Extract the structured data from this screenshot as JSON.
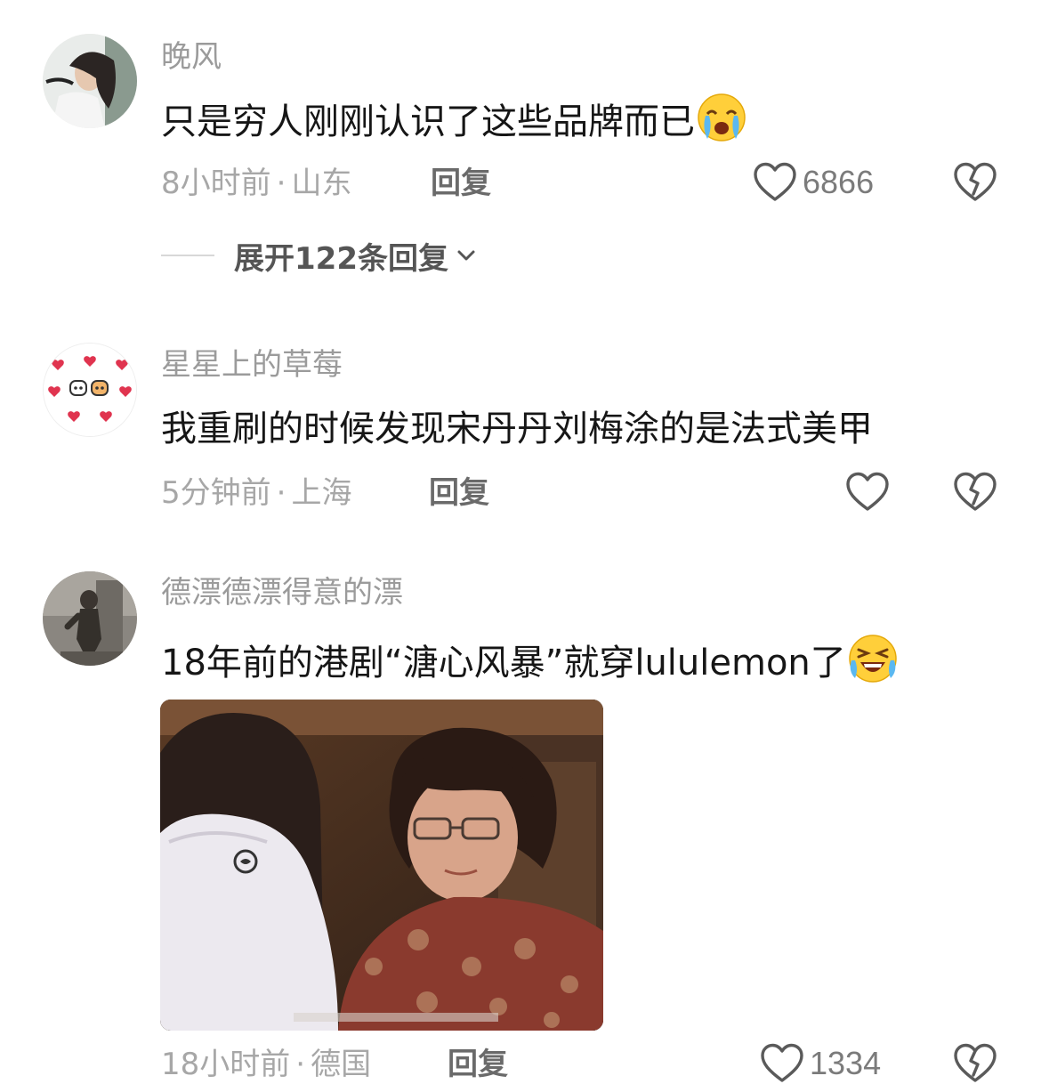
{
  "comments": [
    {
      "username": "晚风",
      "text": "只是穷人刚刚认识了这些品牌而已",
      "emoji": "crying-face-emoji",
      "time": "8小时前",
      "separator": "·",
      "location": "山东",
      "reply_label": "回复",
      "likes": "6866",
      "expand_label": "展开122条回复"
    },
    {
      "username": "星星上的草莓",
      "text": "我重刷的时候发现宋丹丹刘梅涂的是法式美甲",
      "time": "5分钟前",
      "separator": "·",
      "location": "上海",
      "reply_label": "回复",
      "likes": ""
    },
    {
      "username": "德漂德漂得意的漂",
      "text": "18年前的港剧“溏心风暴”就穿lululemon了",
      "emoji": "rolling-laughing-emoji",
      "time": "18小时前",
      "separator": "·",
      "location": "德国",
      "reply_label": "回复",
      "likes": "1334"
    }
  ],
  "colors": {
    "username": "#9b9b9b",
    "body_text": "#161616",
    "meta": "#a7a7a7",
    "reply": "#6a6a6a",
    "like_count": "#7b7b7b",
    "icon": "#5a5a5a"
  }
}
